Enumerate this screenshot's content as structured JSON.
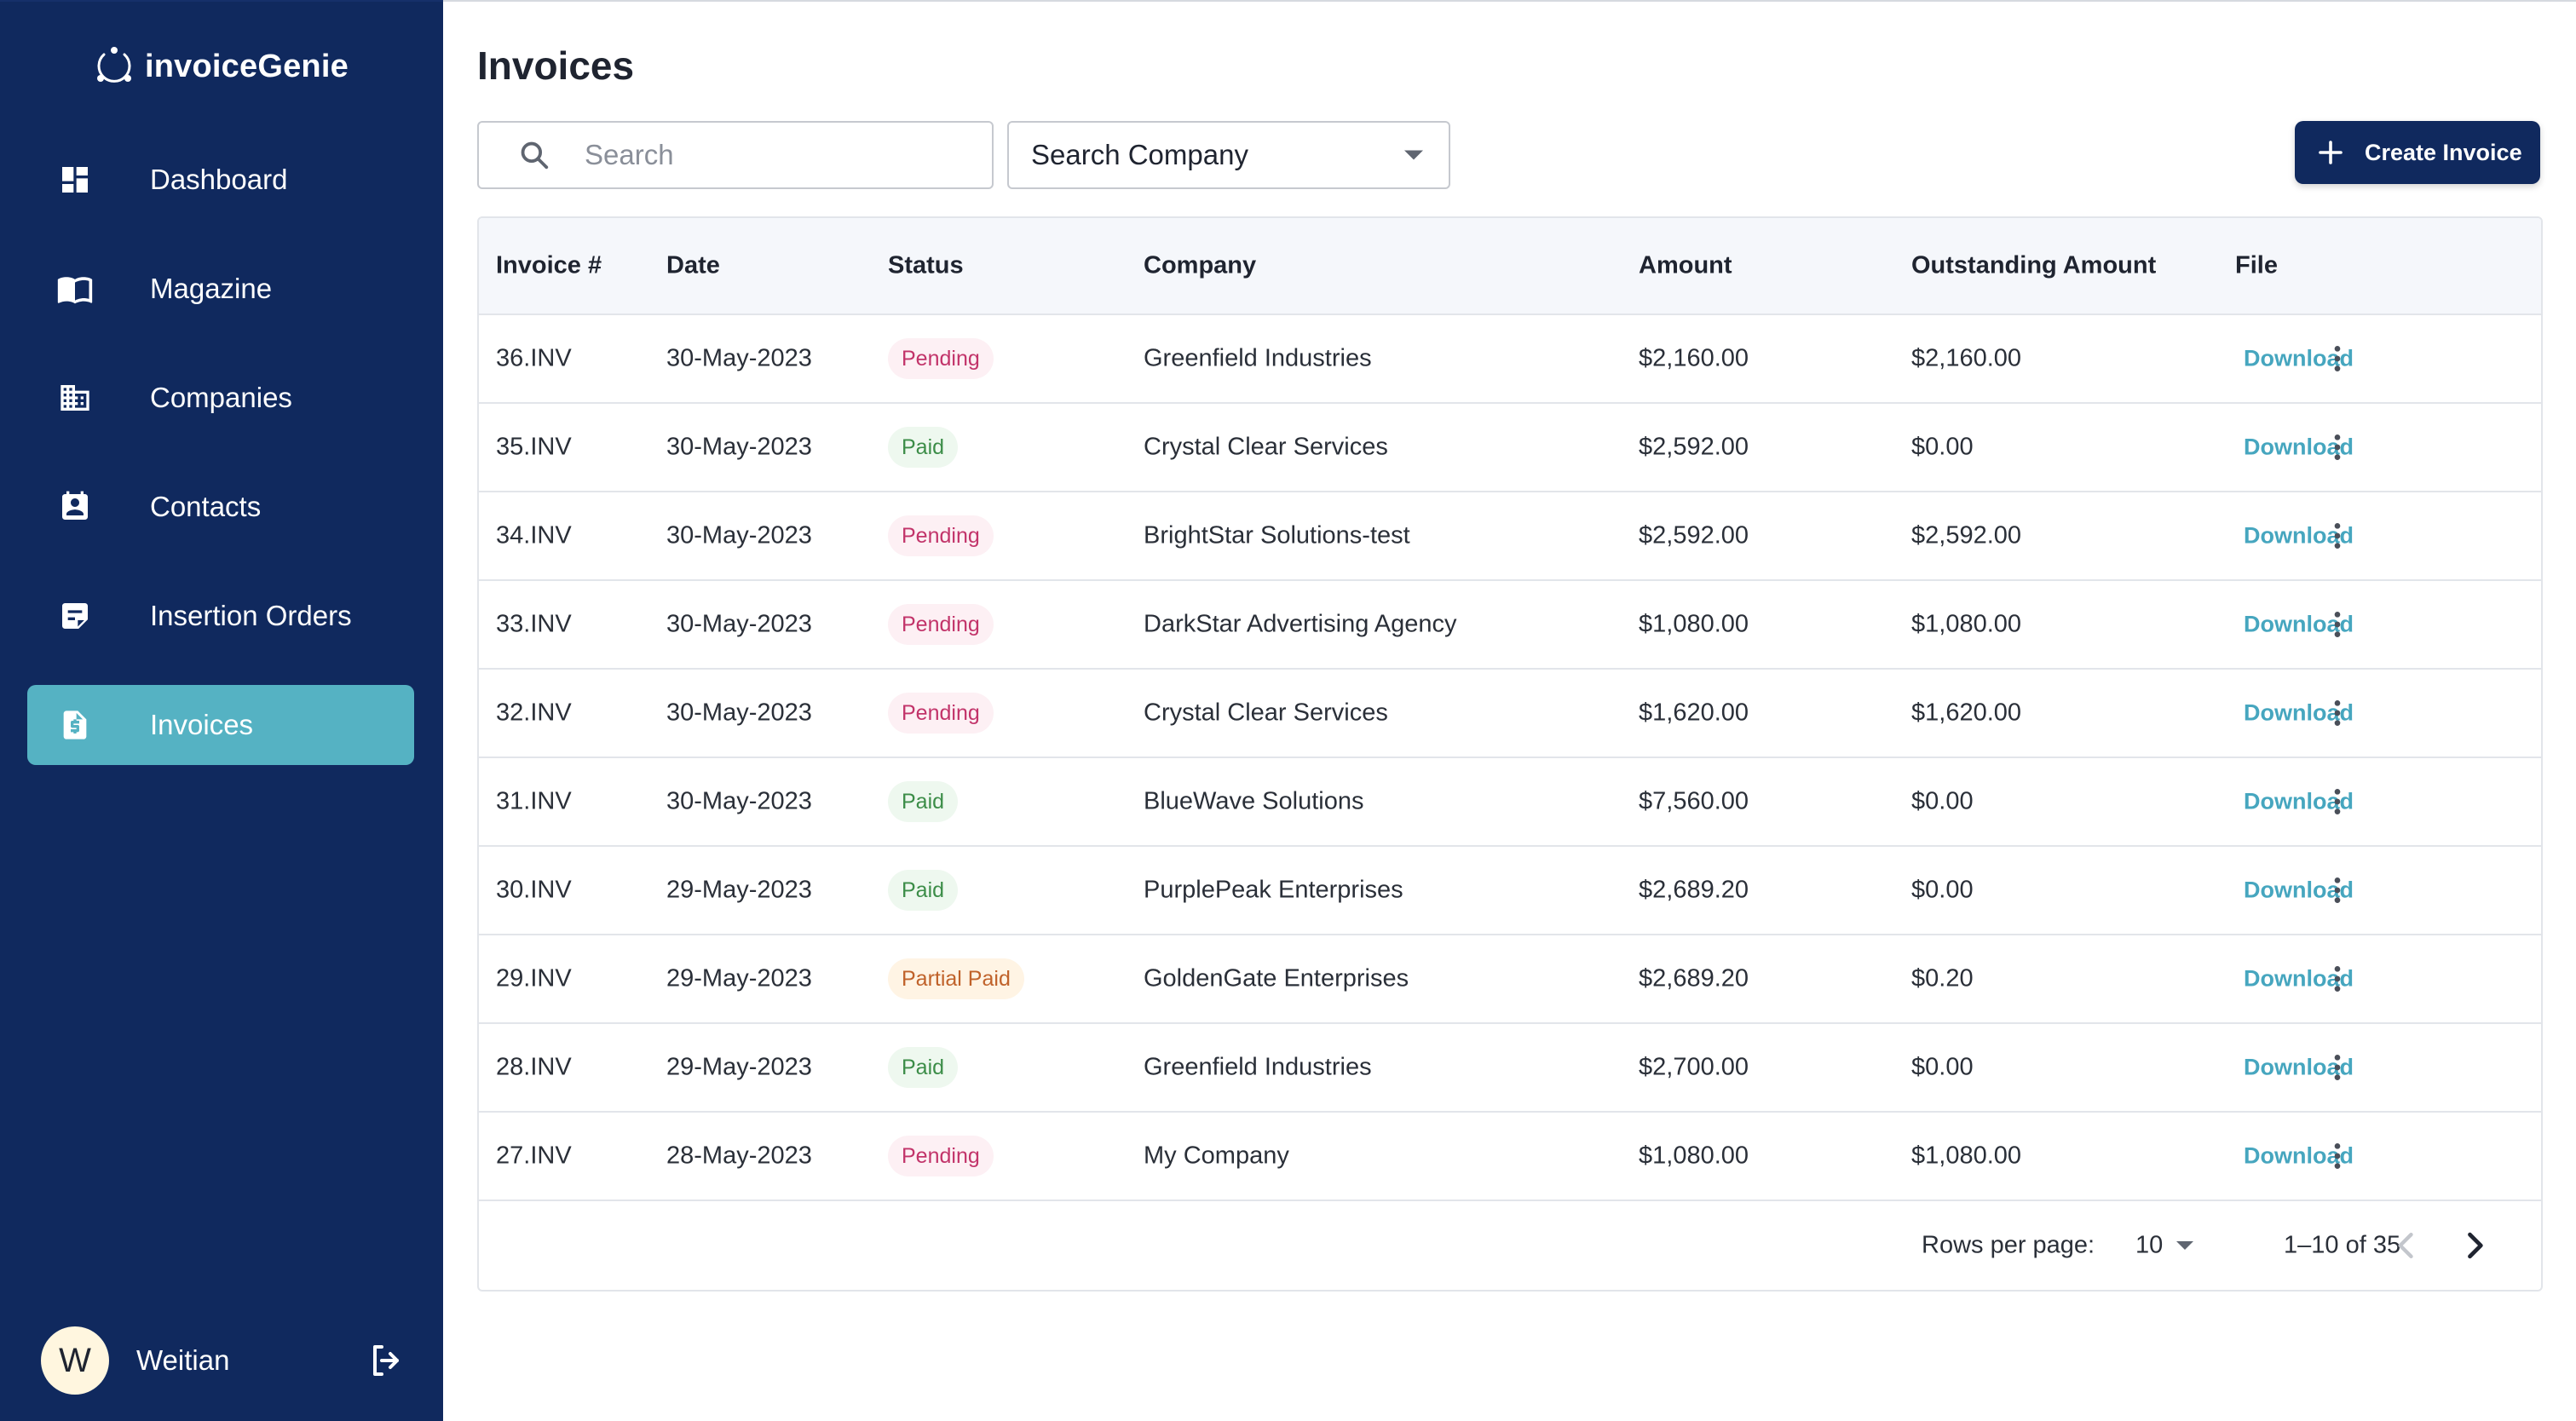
{
  "app": {
    "brand": "invoiceGenie",
    "colors": {
      "sidebar": "#10295e",
      "accent": "#55b2c3",
      "link": "#46a6bf",
      "primary_button": "#10295e"
    }
  },
  "sidebar": {
    "items": [
      {
        "label": "Dashboard",
        "icon": "dashboard-icon",
        "active": false
      },
      {
        "label": "Magazine",
        "icon": "book-icon",
        "active": false
      },
      {
        "label": "Companies",
        "icon": "building-icon",
        "active": false
      },
      {
        "label": "Contacts",
        "icon": "contact-card-icon",
        "active": false
      },
      {
        "label": "Insertion Orders",
        "icon": "document-edit-icon",
        "active": false
      },
      {
        "label": "Invoices",
        "icon": "invoice-icon",
        "active": true
      }
    ],
    "user": {
      "initial": "W",
      "name": "Weitian",
      "logout_icon": "logout-icon"
    }
  },
  "main": {
    "title": "Invoices",
    "search": {
      "placeholder": "Search",
      "value": ""
    },
    "company_filter": {
      "label": "Search Company"
    },
    "create_button": {
      "label": "Create Invoice"
    }
  },
  "table": {
    "columns": [
      "Invoice #",
      "Date",
      "Status",
      "Company",
      "Amount",
      "Outstanding Amount",
      "File"
    ],
    "rows": [
      {
        "invoice": "36.INV",
        "date": "30-May-2023",
        "status": "Pending",
        "company": "Greenfield Industries",
        "amount": "$2,160.00",
        "outstanding": "$2,160.00",
        "file": "Download"
      },
      {
        "invoice": "35.INV",
        "date": "30-May-2023",
        "status": "Paid",
        "company": "Crystal Clear Services",
        "amount": "$2,592.00",
        "outstanding": "$0.00",
        "file": "Download"
      },
      {
        "invoice": "34.INV",
        "date": "30-May-2023",
        "status": "Pending",
        "company": "BrightStar Solutions-test",
        "amount": "$2,592.00",
        "outstanding": "$2,592.00",
        "file": "Download"
      },
      {
        "invoice": "33.INV",
        "date": "30-May-2023",
        "status": "Pending",
        "company": "DarkStar Advertising Agency",
        "amount": "$1,080.00",
        "outstanding": "$1,080.00",
        "file": "Download"
      },
      {
        "invoice": "32.INV",
        "date": "30-May-2023",
        "status": "Pending",
        "company": "Crystal Clear Services",
        "amount": "$1,620.00",
        "outstanding": "$1,620.00",
        "file": "Download"
      },
      {
        "invoice": "31.INV",
        "date": "30-May-2023",
        "status": "Paid",
        "company": "BlueWave Solutions",
        "amount": "$7,560.00",
        "outstanding": "$0.00",
        "file": "Download"
      },
      {
        "invoice": "30.INV",
        "date": "29-May-2023",
        "status": "Paid",
        "company": "PurplePeak Enterprises",
        "amount": "$2,689.20",
        "outstanding": "$0.00",
        "file": "Download"
      },
      {
        "invoice": "29.INV",
        "date": "29-May-2023",
        "status": "Partial Paid",
        "company": "GoldenGate Enterprises",
        "amount": "$2,689.20",
        "outstanding": "$0.20",
        "file": "Download"
      },
      {
        "invoice": "28.INV",
        "date": "29-May-2023",
        "status": "Paid",
        "company": "Greenfield Industries",
        "amount": "$2,700.00",
        "outstanding": "$0.00",
        "file": "Download"
      },
      {
        "invoice": "27.INV",
        "date": "28-May-2023",
        "status": "Pending",
        "company": "My Company",
        "amount": "$1,080.00",
        "outstanding": "$1,080.00",
        "file": "Download"
      }
    ],
    "status_colors": {
      "Pending": {
        "bg": "#fdf0f4",
        "fg": "#c2346a"
      },
      "Paid": {
        "bg": "#eef8ef",
        "fg": "#3c8d48"
      },
      "Partial Paid": {
        "bg": "#fff4e4",
        "fg": "#c0622a"
      }
    }
  },
  "pagination": {
    "rows_per_page_label": "Rows per page:",
    "rows_per_page_value": "10",
    "range_text": "1–10 of 35",
    "prev_icon": "chevron-left-icon",
    "next_icon": "chevron-right-icon",
    "prev_enabled": false,
    "next_enabled": true
  }
}
